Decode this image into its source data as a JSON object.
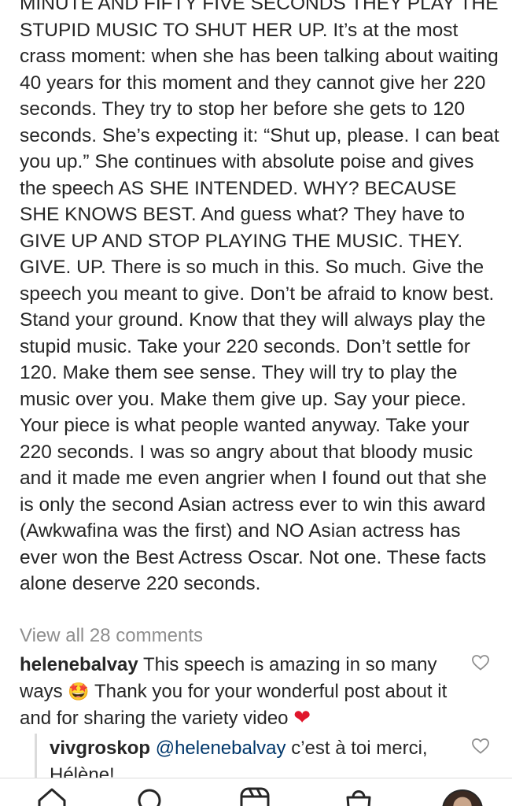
{
  "post": {
    "caption": "MINUTE AND FIFTY FIVE SECONDS THEY PLAY THE STUPID MUSIC TO SHUT HER UP. It’s at the most crass moment: when she has been talking about waiting 40 years for this moment and they cannot give her 220 seconds. They try to stop her before she gets to 120 seconds. She’s expecting it: “Shut up, please. I can beat you up.” She continues with absolute poise and gives the speech AS SHE INTENDED. WHY? BECAUSE SHE KNOWS BEST. And guess what? They have to GIVE UP AND STOP PLAYING THE MUSIC. THEY. GIVE. UP. There is so much in this. So much. Give the speech you meant to give. Don’t be afraid to know best. Stand your ground. Know that they will always play the stupid music. Take your 220 seconds. Don’t settle for 120. Make them see sense. They will try to play the music over you. Make them give up. Say your piece. Your piece is what people wanted anyway. Take your 220 seconds. I was so angry about that bloody music and it made me even angrier when I found out that she is only the second Asian actress ever to win this award (Awkwafina was the first) and NO Asian actress has ever won the Best Actress Oscar. Not one. These facts alone deserve 220 seconds."
  },
  "comments": {
    "view_all_label": "View all 28 comments",
    "items": [
      {
        "username": "helenebalvay",
        "text_part1": "This speech is amazing in so many ways",
        "emoji1": "🤩",
        "text_part2": "Thank you for your wonderful post about it and for sharing the variety video",
        "emoji2": "❤"
      }
    ],
    "reply": {
      "username": "vivgroskop",
      "mention": "@helenebalvay",
      "text": "c’est à toi merci, Hélène!"
    }
  },
  "nav": {
    "icons": [
      "home-icon",
      "search-icon",
      "reels-icon",
      "shop-icon",
      "profile-avatar"
    ]
  },
  "colors": {
    "text": "#262626",
    "muted": "#8e8e8e",
    "mention": "#00376b",
    "heart": "#e0162b"
  }
}
